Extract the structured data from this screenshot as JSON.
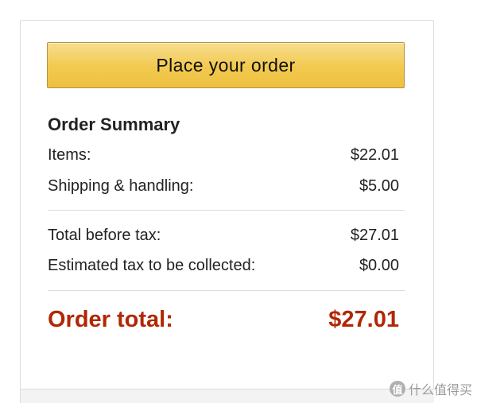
{
  "place_order_button": {
    "label": "Place your order",
    "color": "#f0c14b"
  },
  "order_summary": {
    "title": "Order Summary",
    "rows": [
      {
        "label": "Items:",
        "value": "$22.01"
      },
      {
        "label": "Shipping & handling:",
        "value": "$5.00"
      },
      {
        "label": "Total before tax:",
        "value": "$27.01"
      },
      {
        "label": "Estimated tax to be collected:",
        "value": "$0.00"
      }
    ],
    "total": {
      "label": "Order total:",
      "value": "$27.01",
      "color": "#b12704"
    }
  },
  "watermark": {
    "logo_text": "值",
    "text": "什么值得买"
  }
}
